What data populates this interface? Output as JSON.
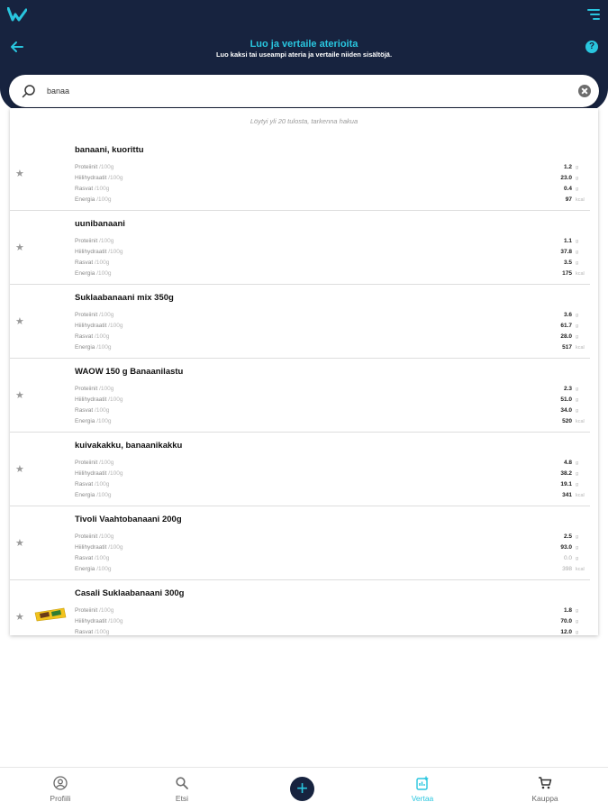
{
  "header": {
    "title": "Luo ja vertaile aterioita",
    "subtitle": "Luo kaksi tai useampi ateria ja vertaile niiden sisältöjä."
  },
  "search": {
    "value": "banaa",
    "placeholder": ""
  },
  "results": {
    "found_text": "Löytyi yli 20 tulosta, tarkenna hakua",
    "items": [
      {
        "name": "banaani, kuorittu",
        "nutrients": [
          {
            "label": "Proteiinit",
            "per": "/100g",
            "value": "1.2",
            "unit": "g"
          },
          {
            "label": "Hiilihydraatit",
            "per": "/100g",
            "value": "23.0",
            "unit": "g"
          },
          {
            "label": "Rasvat",
            "per": "/100g",
            "value": "0.4",
            "unit": "g"
          },
          {
            "label": "Energia",
            "per": "/100g",
            "value": "97",
            "unit": "kcal"
          }
        ]
      },
      {
        "name": "uunibanaani",
        "nutrients": [
          {
            "label": "Proteiinit",
            "per": "/100g",
            "value": "1.1",
            "unit": "g"
          },
          {
            "label": "Hiilihydraatit",
            "per": "/100g",
            "value": "37.8",
            "unit": "g"
          },
          {
            "label": "Rasvat",
            "per": "/100g",
            "value": "3.5",
            "unit": "g"
          },
          {
            "label": "Energia",
            "per": "/100g",
            "value": "175",
            "unit": "kcal"
          }
        ]
      },
      {
        "name": "Suklaabanaani mix 350g",
        "nutrients": [
          {
            "label": "Proteiinit",
            "per": "/100g",
            "value": "3.6",
            "unit": "g"
          },
          {
            "label": "Hiilihydraatit",
            "per": "/100g",
            "value": "61.7",
            "unit": "g"
          },
          {
            "label": "Rasvat",
            "per": "/100g",
            "value": "28.0",
            "unit": "g"
          },
          {
            "label": "Energia",
            "per": "/100g",
            "value": "517",
            "unit": "kcal"
          }
        ]
      },
      {
        "name": "WAOW 150 g Banaanilastu",
        "nutrients": [
          {
            "label": "Proteiinit",
            "per": "/100g",
            "value": "2.3",
            "unit": "g"
          },
          {
            "label": "Hiilihydraatit",
            "per": "/100g",
            "value": "51.0",
            "unit": "g"
          },
          {
            "label": "Rasvat",
            "per": "/100g",
            "value": "34.0",
            "unit": "g"
          },
          {
            "label": "Energia",
            "per": "/100g",
            "value": "520",
            "unit": "kcal"
          }
        ]
      },
      {
        "name": "kuivakakku, banaanikakku",
        "nutrients": [
          {
            "label": "Proteiinit",
            "per": "/100g",
            "value": "4.8",
            "unit": "g"
          },
          {
            "label": "Hiilihydraatit",
            "per": "/100g",
            "value": "38.2",
            "unit": "g"
          },
          {
            "label": "Rasvat",
            "per": "/100g",
            "value": "19.1",
            "unit": "g"
          },
          {
            "label": "Energia",
            "per": "/100g",
            "value": "341",
            "unit": "kcal"
          }
        ]
      },
      {
        "name": "Tivoli Vaahtobanaani 200g",
        "nutrients": [
          {
            "label": "Proteiinit",
            "per": "/100g",
            "value": "2.5",
            "unit": "g"
          },
          {
            "label": "Hiilihydraatit",
            "per": "/100g",
            "value": "93.0",
            "unit": "g"
          },
          {
            "label": "Rasvat",
            "per": "/100g",
            "value": "0.0",
            "unit": "g",
            "faded": true
          },
          {
            "label": "Energia",
            "per": "/100g",
            "value": "398",
            "unit": "kcal",
            "faded": true
          }
        ]
      },
      {
        "name": "Casali Suklaabanaani 300g",
        "has_image": true,
        "nutrients": [
          {
            "label": "Proteiinit",
            "per": "/100g",
            "value": "1.8",
            "unit": "g"
          },
          {
            "label": "Hiilihydraatit",
            "per": "/100g",
            "value": "70.0",
            "unit": "g"
          },
          {
            "label": "Rasvat",
            "per": "/100g",
            "value": "12.0",
            "unit": "g"
          }
        ]
      }
    ]
  },
  "nav": {
    "items": [
      {
        "label": "Profiili",
        "icon": "profile-icon"
      },
      {
        "label": "Etsi",
        "icon": "search-icon"
      },
      {
        "label": "Vertaa",
        "icon": "compare-icon",
        "active": true
      },
      {
        "label": "Kauppa",
        "icon": "cart-icon"
      }
    ],
    "add_label": "+"
  },
  "colors": {
    "header_bg": "#17233f",
    "accent": "#29c6df"
  }
}
